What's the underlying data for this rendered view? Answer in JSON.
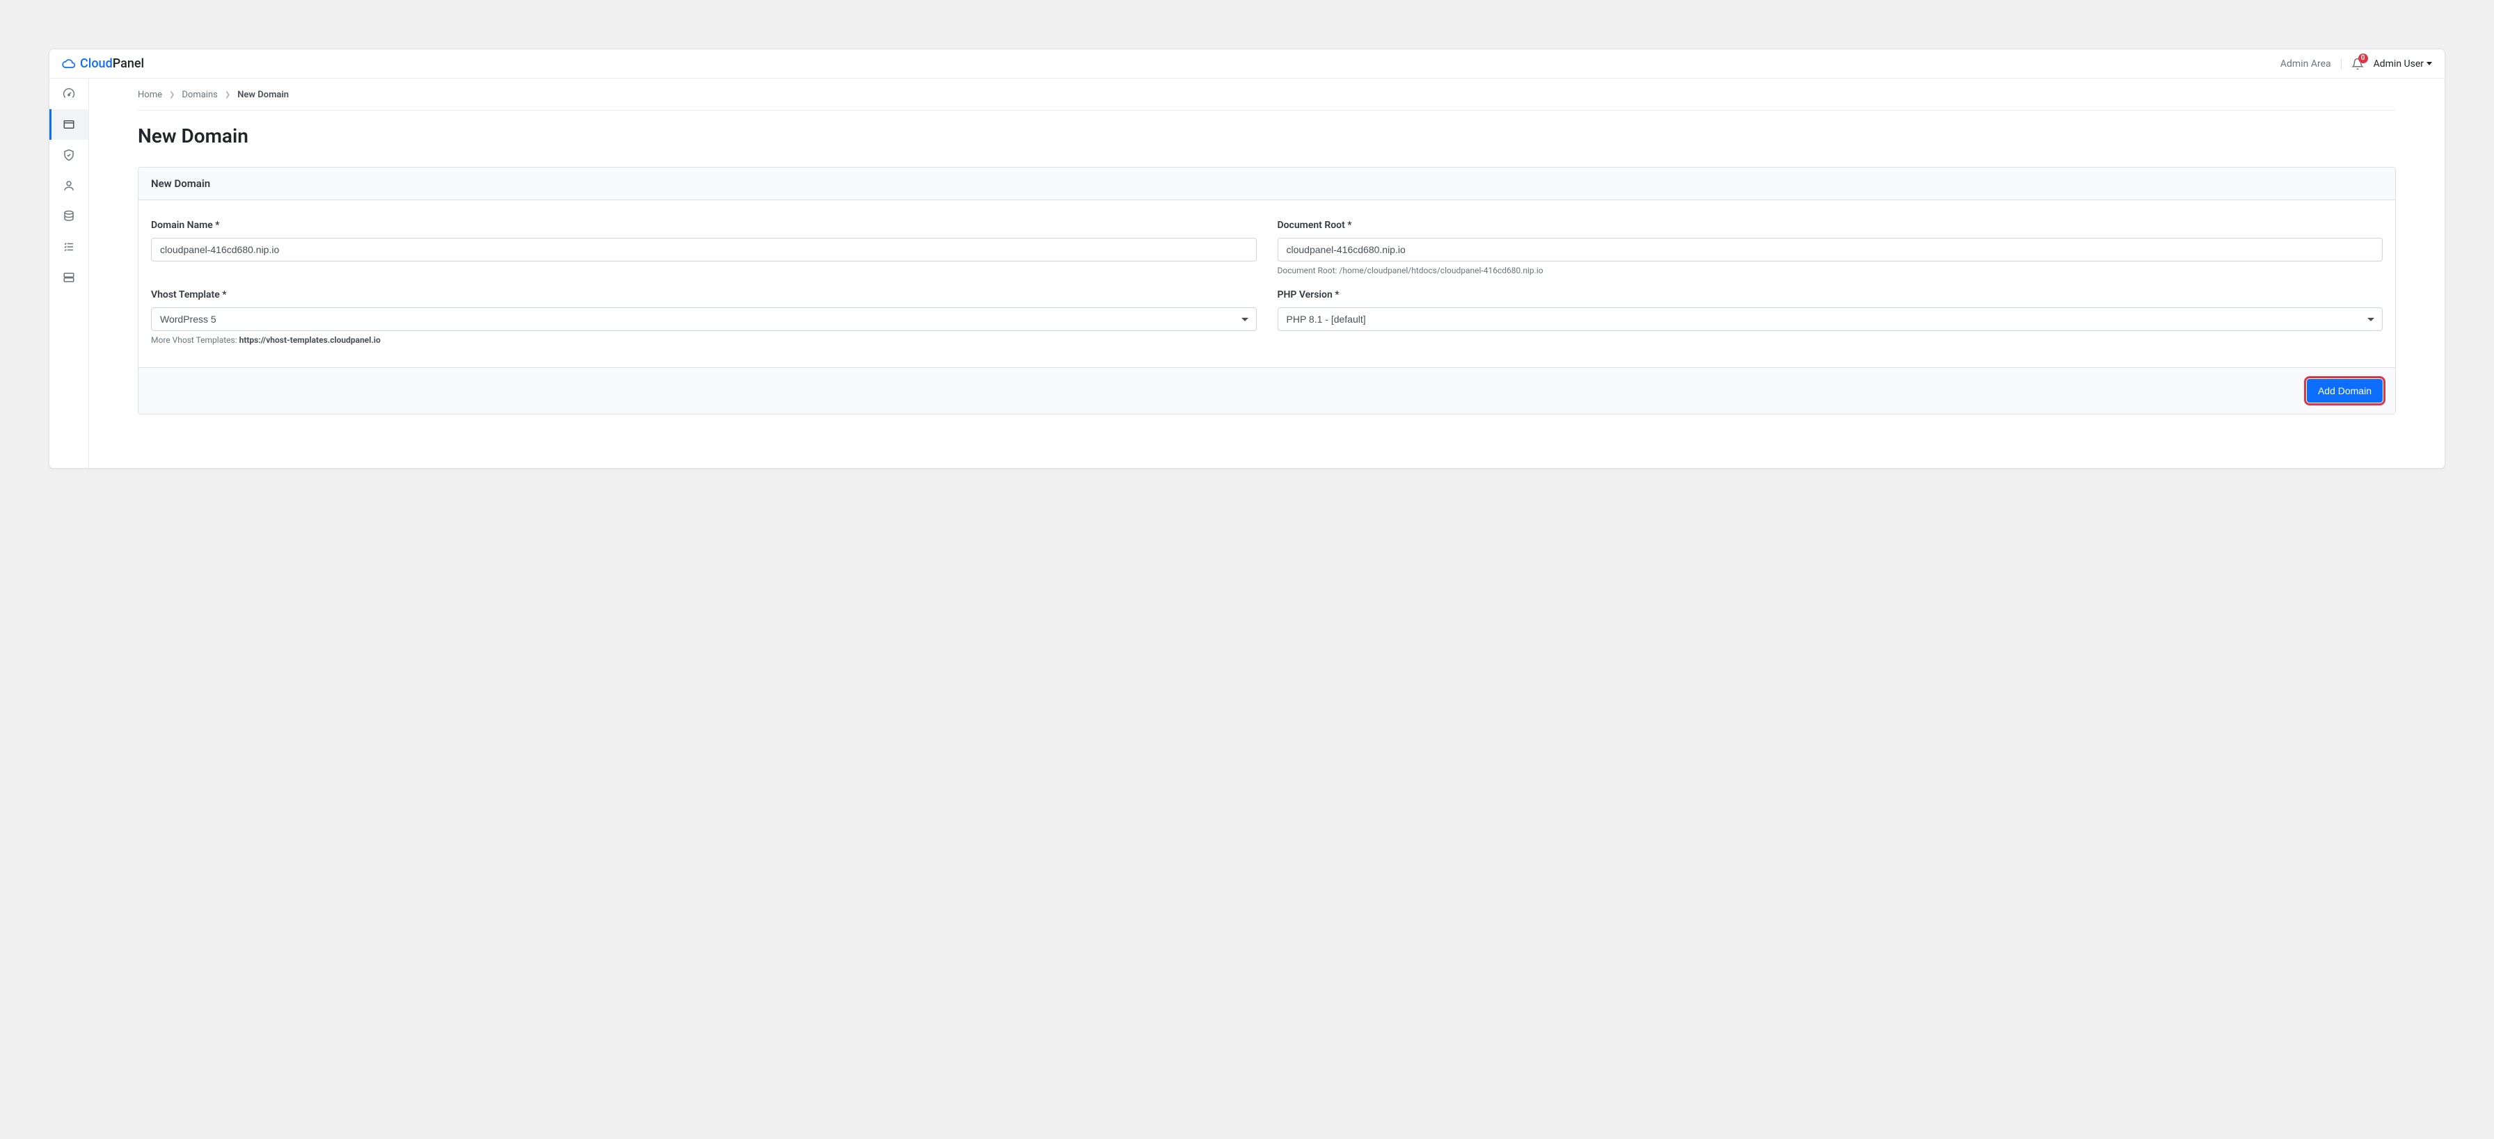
{
  "brand": {
    "cloud": "Cloud",
    "panel": "Panel"
  },
  "topbar": {
    "admin_area": "Admin Area",
    "notification_count": "0",
    "user_name": "Admin User"
  },
  "breadcrumb": {
    "home": "Home",
    "domains": "Domains",
    "current": "New Domain"
  },
  "page_title": "New Domain",
  "card": {
    "header": "New Domain",
    "domain_name_label": "Domain Name *",
    "domain_name_value": "cloudpanel-416cd680.nip.io",
    "document_root_label": "Document Root *",
    "document_root_value": "cloudpanel-416cd680.nip.io",
    "document_root_helper_prefix": "Document Root: ",
    "document_root_helper_path": "/home/cloudpanel/htdocs/cloudpanel-416cd680.nip.io",
    "vhost_label": "Vhost Template *",
    "vhost_value": "WordPress 5",
    "vhost_helper_prefix": "More Vhost Templates: ",
    "vhost_helper_link": "https://vhost-templates.cloudpanel.io",
    "php_label": "PHP Version *",
    "php_value": "PHP 8.1 - [default]",
    "submit": "Add Domain"
  }
}
